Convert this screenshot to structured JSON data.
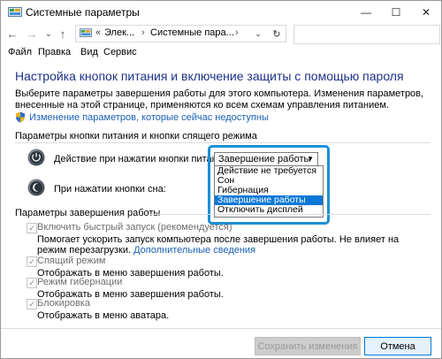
{
  "window": {
    "title": "Системные параметры"
  },
  "nav": {
    "breadcrumbs": [
      "Элек...",
      "Системные пара..."
    ],
    "back_glyph": "←",
    "forward_glyph": "→",
    "recent_glyph": "⌄",
    "up_glyph": "↑",
    "addr_dd_glyph": "⌄",
    "refresh_glyph": "↻",
    "search_placeholder": ""
  },
  "menu": [
    "Файл",
    "Правка",
    "Вид",
    "Сервис"
  ],
  "main": {
    "heading": "Настройка кнопок питания и включение защиты с помощью пароля",
    "description": "Выберите параметры завершения работы для этого компьютера. Изменения параметров, внесенные на этой странице, применяются ко всем схемам управления питанием.",
    "change_link": "Изменение параметров, которые сейчас недоступны"
  },
  "power_buttons": {
    "section_title": "Параметры кнопки питания и кнопки спящего режима",
    "power_label": "Действие при нажатии кнопки питания:",
    "sleep_label": "При нажатии кнопки сна:",
    "selected_value": "Завершение работы",
    "options": [
      "Действие не требуется",
      "Сон",
      "Гибернация",
      "Завершение работы",
      "Отключить дисплей"
    ]
  },
  "shutdown": {
    "section_title": "Параметры завершения работы",
    "items": [
      {
        "label": "Включить быстрый запуск (рекомендуется)",
        "desc": "Помогает ускорить запуск компьютера после завершения работы. Не влияет на режим перезагрузки.",
        "link": "Дополнительные сведения",
        "checked": true
      },
      {
        "label": "Спящий режим",
        "desc": "Отображать в меню завершения работы.",
        "checked": true
      },
      {
        "label": "Режим гибернации",
        "desc": "Отображать в меню завершения работы.",
        "checked": true
      },
      {
        "label": "Блокировка",
        "desc": "Отображать в меню аватара.",
        "checked": true
      }
    ]
  },
  "footer": {
    "save": "Сохранить изменения",
    "cancel": "Отмена"
  },
  "colors": {
    "heading": "#1e3287",
    "link": "#1a5fb4",
    "highlight": "#1a8fd6",
    "selected_option": "#0a78d7"
  }
}
